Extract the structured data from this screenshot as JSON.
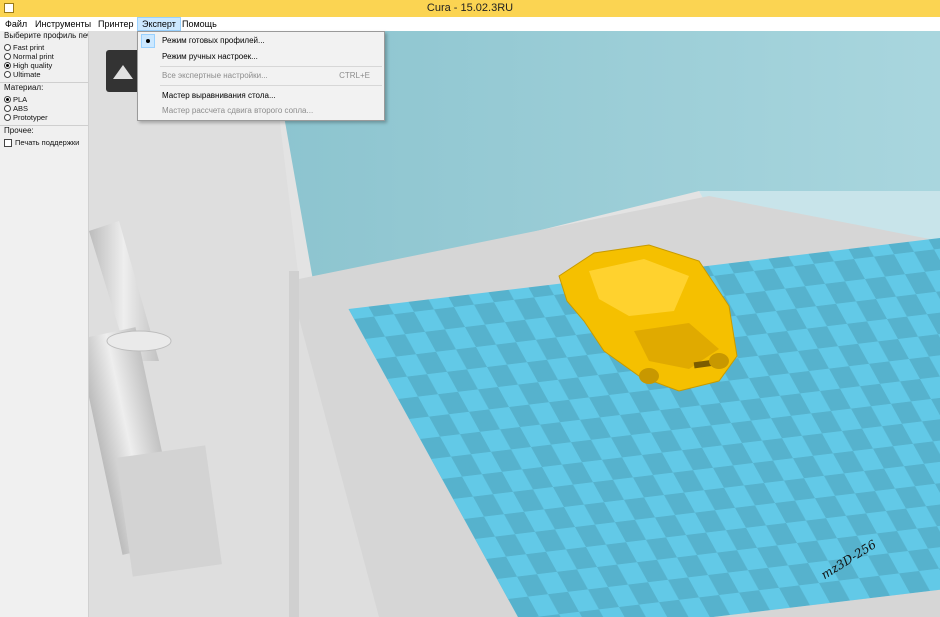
{
  "window": {
    "title": "Cura - 15.02.3RU"
  },
  "menubar": {
    "items": [
      "Файл",
      "Инструменты",
      "Принтер",
      "Эксперт",
      "Помощь"
    ],
    "active": "Эксперт"
  },
  "sidebar": {
    "profile_label": "Выберите профиль печ",
    "profiles": [
      "Fast print",
      "Normal print",
      "High quality",
      "Ultimate"
    ],
    "selected_profile": "High quality",
    "material_label": "Материал:",
    "materials": [
      "PLA",
      "ABS",
      "Prototyper"
    ],
    "selected_material": "PLA",
    "other_label": "Прочее:",
    "support_label": "Печать поддержки",
    "support_checked": false
  },
  "expert_menu": {
    "items": [
      {
        "label": "Режим готовых профилей...",
        "checked": true,
        "enabled": true
      },
      {
        "label": "Режим ручных настроек...",
        "enabled": true
      },
      {
        "label": "Все экспертные настройки...",
        "shortcut": "CTRL+E",
        "enabled": false
      },
      {
        "label": "Мастер выравнивания стола...",
        "enabled": true
      },
      {
        "label": "Мастер рассчета сдвига второго сопла...",
        "enabled": false
      }
    ]
  },
  "scene": {
    "stamp_text": "mz3D-256",
    "build_plate_color": "#5cc8e8",
    "model_color": "#f5c000",
    "back_wall_color": "#9fcfd8"
  }
}
